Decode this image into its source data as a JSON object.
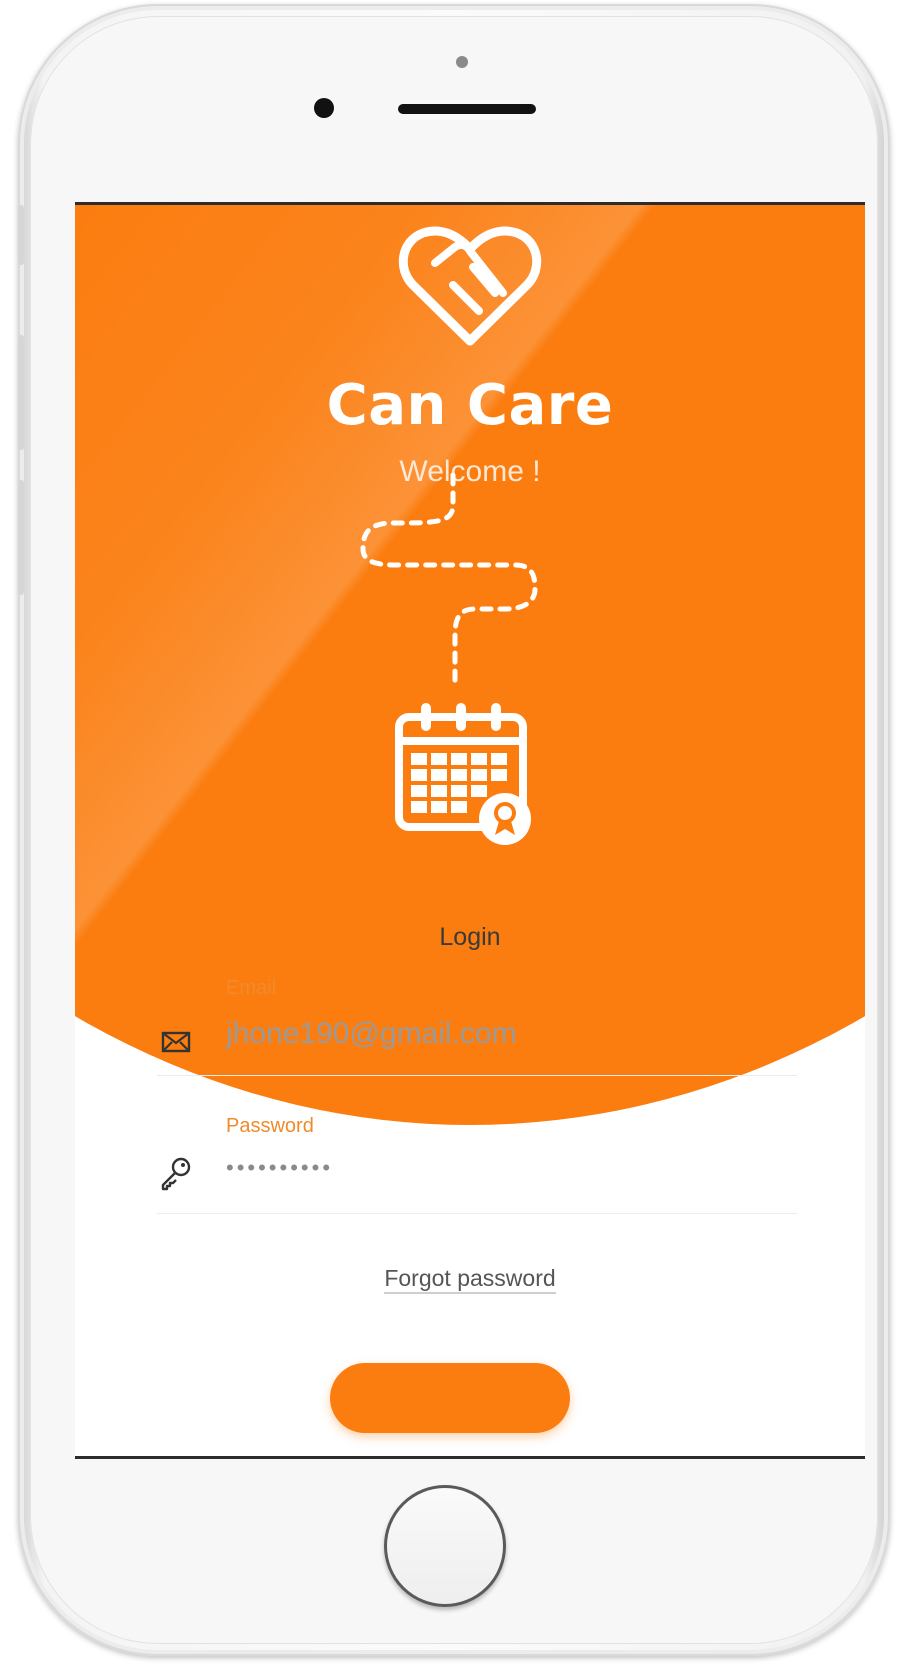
{
  "app": {
    "name": "Can Care",
    "welcome": "Welcome !"
  },
  "login": {
    "title": "Login",
    "email": {
      "label": "Email",
      "value": "jhone190@gmail.com",
      "icon": "envelope-icon"
    },
    "password": {
      "label": "Password",
      "value": "••••••••••",
      "icon": "key-icon"
    },
    "forgot_label": "Forgot password"
  },
  "colors": {
    "accent": "#fb7d10",
    "label": "#f08a2c",
    "muted_text": "#9a9a9a"
  }
}
